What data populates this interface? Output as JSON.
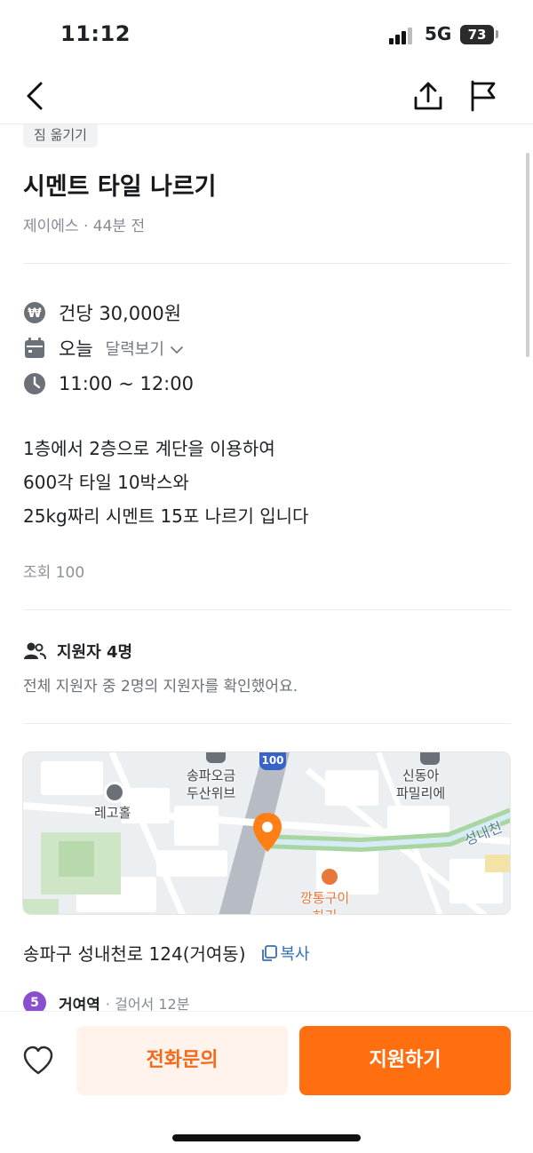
{
  "status_bar": {
    "time": "11:12",
    "network": "5G",
    "battery": "73"
  },
  "nav": {
    "back_icon": "chevron-left-icon",
    "share_icon": "share-icon",
    "report_icon": "flag-icon"
  },
  "post": {
    "category": "짐 옮기기",
    "title": "시멘트 타일 나르기",
    "author": "제이에스",
    "separator": "·",
    "time_ago": "44분 전",
    "pay": "건당 30,000원",
    "date": "오늘",
    "calendar_link": "달력보기",
    "time_range": "11:00 ~ 12:00",
    "description_lines": [
      "1층에서 2층으로 계단을 이용하여",
      "600각 타일 10박스와",
      "25kg짜리 시멘트 15포 나르기 입니다"
    ],
    "views": "조회 100"
  },
  "applicants": {
    "title": "지원자 4명",
    "description": "전체 지원자 중 2명의 지원자를 확인했어요."
  },
  "map": {
    "labels": {
      "place_1": "송파오금\n두산위브",
      "place_2": "신동아\n파밀리에",
      "place_3": "레고홀",
      "place_4": "깡통구이\n하기",
      "road": "성내천",
      "highway": "100"
    }
  },
  "location": {
    "address": "송파구 성내천로 124(거여동)",
    "copy_label": "복사",
    "subway_line": "5",
    "station": "거여역",
    "walk_time": "· 걸어서 12분"
  },
  "actions": {
    "call_label": "전화문의",
    "apply_label": "지원하기"
  },
  "colors": {
    "accent": "#ff6f0f",
    "accent_light": "#fff3ec",
    "subway_line_5": "#8a4fd1",
    "link": "#356fb3"
  }
}
